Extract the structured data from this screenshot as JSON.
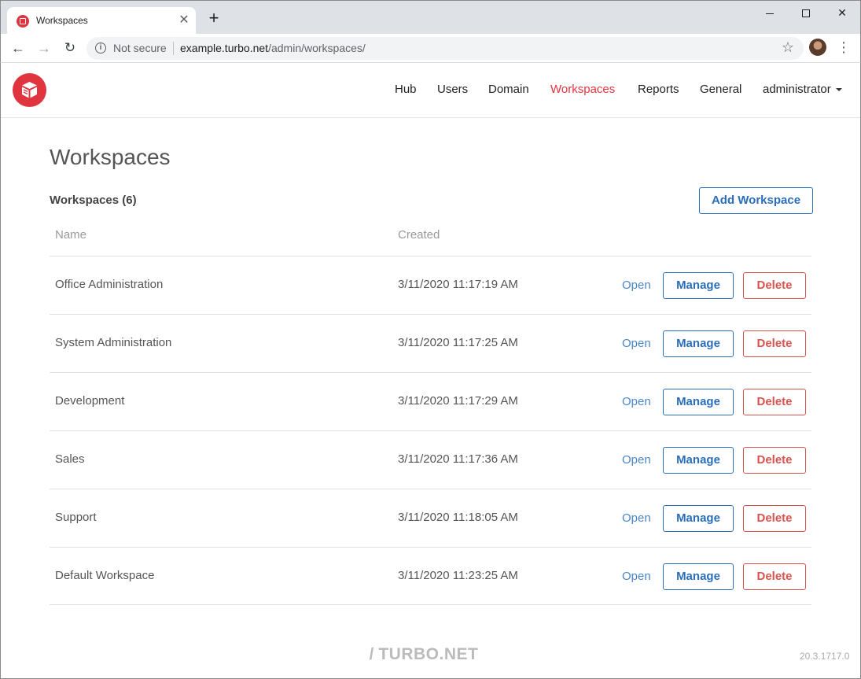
{
  "browser": {
    "tab_title": "Workspaces",
    "not_secure": "Not secure",
    "url_host": "example.turbo.net",
    "url_path": "/admin/workspaces/"
  },
  "nav": {
    "items": [
      "Hub",
      "Users",
      "Domain",
      "Workspaces",
      "Reports",
      "General"
    ],
    "active": "Workspaces",
    "user": "administrator"
  },
  "page": {
    "title": "Workspaces",
    "count_label": "Workspaces (6)",
    "add_button": "Add Workspace",
    "columns": {
      "name": "Name",
      "created": "Created"
    },
    "actions": {
      "open": "Open",
      "manage": "Manage",
      "delete": "Delete"
    }
  },
  "workspaces": [
    {
      "name": "Office Administration",
      "created": "3/11/2020 11:17:19 AM"
    },
    {
      "name": "System Administration",
      "created": "3/11/2020 11:17:25 AM"
    },
    {
      "name": "Development",
      "created": "3/11/2020 11:17:29 AM"
    },
    {
      "name": "Sales",
      "created": "3/11/2020 11:17:36 AM"
    },
    {
      "name": "Support",
      "created": "3/11/2020 11:18:05 AM"
    },
    {
      "name": "Default Workspace",
      "created": "3/11/2020 11:23:25 AM"
    }
  ],
  "footer": {
    "brand": "TURBO.NET",
    "version": "20.3.1717.0"
  },
  "colors": {
    "brand_red": "#e0353f",
    "primary_blue": "#2a6ebb",
    "danger_red": "#d9534f"
  }
}
